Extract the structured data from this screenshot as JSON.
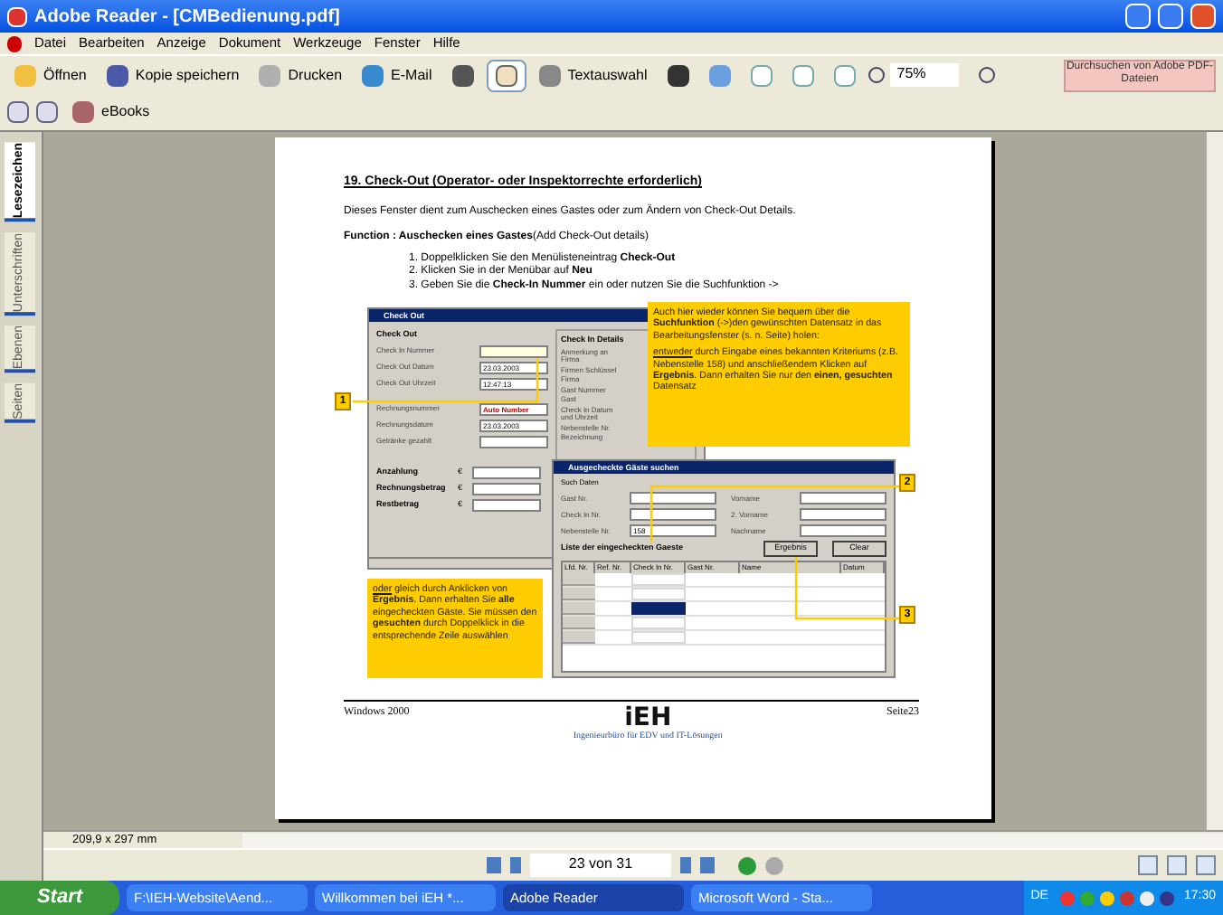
{
  "window": {
    "title": "Adobe Reader - [CMBedienung.pdf]"
  },
  "menu": [
    "Datei",
    "Bearbeiten",
    "Anzeige",
    "Dokument",
    "Werkzeuge",
    "Fenster",
    "Hilfe"
  ],
  "toolbar": {
    "open": "Öffnen",
    "save_copy": "Kopie speichern",
    "print": "Drucken",
    "email": "E-Mail",
    "hand_selected": true,
    "select_text": "Textauswahl",
    "zoom": "75%",
    "search_adobe": "Durchsuchen von Adobe PDF-Dateien",
    "ebooks": "eBooks"
  },
  "side_tabs": [
    {
      "label": "Lesezeichen",
      "selected": true
    },
    {
      "label": "Unterschriften",
      "selected": false
    },
    {
      "label": "Ebenen",
      "selected": false
    },
    {
      "label": "Seiten",
      "selected": false
    }
  ],
  "page": {
    "heading": "19. Check-Out (Operator- oder Inspektorrechte erforderlich)",
    "intro": "Dieses Fenster dient zum Auschecken eines Gastes oder zum Ändern von Check-Out Details.",
    "function": "**Function : Auschecken eines Gastes**(Add Check-Out details)",
    "steps": [
      "1. Doppelklicken Sie den Menülisteneintrag **Check-Out**",
      "2. Klicken Sie in der Menübar auf **Neu**",
      "3. Geben Sie die **Check-In Nummer** ein oder nutzen Sie die Suchfunktion ->"
    ],
    "check_out_window": {
      "title": "Check Out",
      "group": "Check Out",
      "fields": [
        {
          "label": "Check In Nummer",
          "kind": "lookup"
        },
        {
          "label": "Check Out Datum",
          "kind": "date",
          "value": "23.03.2003"
        },
        {
          "label": "Check Out Uhrzeit",
          "kind": "time",
          "value": "12:47:13"
        },
        {
          "label": "Rechnungsnummer",
          "kind": "auto",
          "value": "Auto Number"
        },
        {
          "label": "Rechnungsdatum",
          "kind": "date",
          "value": "23.03.2003"
        },
        {
          "label": "Getränke gezahlt",
          "kind": "text"
        }
      ],
      "amounts": [
        {
          "label": "Anzahlung",
          "currency": "€"
        },
        {
          "label": "Rechnungsbetrag",
          "currency": "€"
        },
        {
          "label": "Restbetrag",
          "currency": "€"
        }
      ],
      "details_group": "Check In Details",
      "details": [
        "Anmerkung an Firma",
        "Firmen Schlüssel",
        "Firma",
        "Gast Nummer",
        "Gast",
        "Check In Datum und Uhrzeit",
        "Nebenstelle Nr.",
        "Bezeichnung"
      ]
    },
    "callout_top": [
      {
        "text": "Auch hier wieder können Sie bequem über die **Suchfunktion** (->)den gewünschten Datensatz in das Bearbeitungsfenster (s. n. Seite) holen:"
      },
      {
        "lead": "entweder",
        "text": " durch Eingabe eines bekannten Kriteriums (z.B. Nebenstelle 158) und anschließendem Klicken auf **Ergebnis**. Dann erhalten Sie nur den **einen, gesuchten** Datensatz"
      }
    ],
    "callout_bottom": {
      "lead": "oder",
      "text": " gleich durch Anklicken von **Ergebnis**. Dann erhalten Sie **alle** eingecheckten Gäste. Sie müssen den **gesuchten** durch Doppelklick in die entsprechende Zeile auswählen"
    },
    "search_window": {
      "title": "Ausgecheckte Gäste suchen",
      "group": "Such Daten",
      "left_fields": [
        {
          "label": "Gast Nr."
        },
        {
          "label": "Check In Nr."
        },
        {
          "label": "Nebenstelle Nr.",
          "value": "158"
        }
      ],
      "right_fields": [
        {
          "label": "Vorname"
        },
        {
          "label": "2. Vorname"
        },
        {
          "label": "Nachname"
        }
      ],
      "list_title": "Liste der eingecheckten Gaeste",
      "buttons": [
        "Ergebnis",
        "Clear"
      ],
      "columns": [
        "Lfd. Nr.",
        "Ref. Nr.",
        "Check In Nr.",
        "Gast Nr.",
        "Name",
        "Datum"
      ],
      "rows": [
        {
          "selected": false
        },
        {
          "selected": false
        },
        {
          "selected": true
        },
        {
          "selected": false
        },
        {
          "selected": false
        }
      ]
    },
    "markers": [
      "1",
      "2",
      "3"
    ],
    "footer": {
      "left": "Windows 2000",
      "logo": "iEH",
      "logo_sub": "Ingenieurbüro für EDV und IT-Lösungen",
      "right": "Seite23"
    }
  },
  "status": {
    "page_size": "209,9 x 297 mm",
    "page_nav": "23 von 31"
  },
  "taskbar": {
    "start": "Start",
    "tasks": [
      {
        "label": "F:\\IEH-Website\\Aend...",
        "selected": false
      },
      {
        "label": "Willkommen bei iEH *...",
        "selected": false
      },
      {
        "label": "Adobe Reader",
        "selected": true
      },
      {
        "label": "Microsoft Word - Sta...",
        "selected": false
      }
    ],
    "language": "DE",
    "clock": "17:30"
  }
}
